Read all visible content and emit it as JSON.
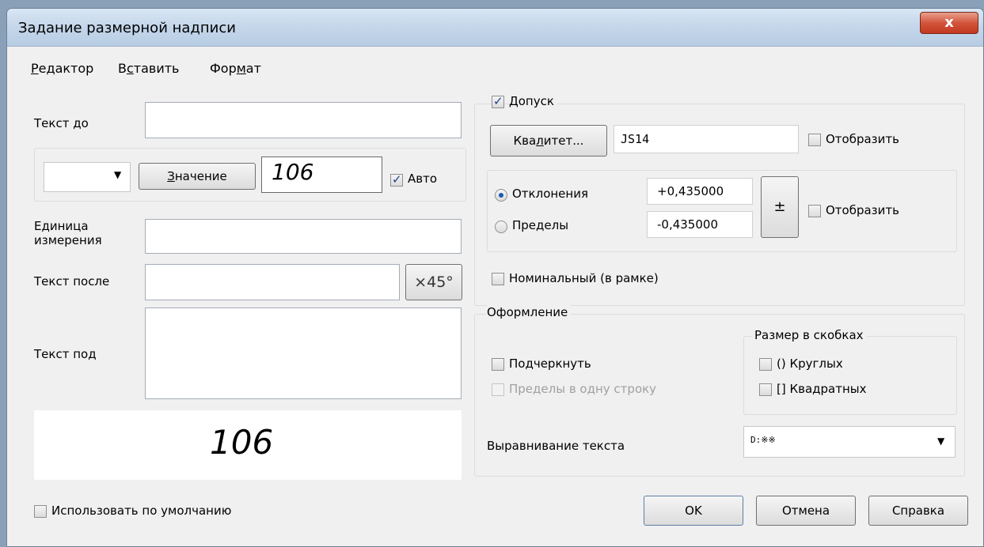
{
  "window": {
    "title": "Задание размерной надписи",
    "close_glyph": "x"
  },
  "menu": [
    {
      "pre": "",
      "acc": "Р",
      "post": "едактор"
    },
    {
      "pre": "В",
      "acc": "с",
      "post": "тавить"
    },
    {
      "pre": "Фор",
      "acc": "м",
      "post": "ат"
    }
  ],
  "left": {
    "text_before_label": "Текст до",
    "text_before_value": "",
    "prefix_select_value": "",
    "value_button": {
      "acc": "З",
      "post": "начение"
    },
    "value": "106",
    "auto_label": "Авто",
    "unit_label_line1": "Единица",
    "unit_label_line2": "измерения",
    "unit_value": "",
    "text_after_label": "Текст после",
    "text_after_value": "",
    "x45_button": "×45°",
    "text_under_label": "Текст под",
    "text_under_value": "",
    "preview_value": "106",
    "use_default_label": "Использовать по умолчанию"
  },
  "tolerance": {
    "enabled_label": "Допуск",
    "qualitet_button": {
      "pre": "Ква",
      "acc": "л",
      "post": "итет..."
    },
    "qualitet_value": "JS14",
    "show_label": "Отобразить",
    "deviations_label": "Отклонения",
    "limits_label": "Пределы",
    "upper_value": "+0,435000",
    "lower_value": "-0,435000",
    "plusminus_button": "±",
    "show2_label": "Отобразить",
    "nominal_label": "Номинальный (в рамке)"
  },
  "format": {
    "group_label": "Оформление",
    "brackets_group_label": "Размер в скобках",
    "underline_label": "Подчеркнуть",
    "limits_one_line_label": "Пределы в одну строку",
    "round_label": "() Круглых",
    "square_label": "[] Квадратных",
    "align_label": "Выравнивание текста",
    "align_value": "D:※※"
  },
  "buttons": {
    "ok": "OK",
    "cancel": "Отмена",
    "help": "Справка"
  }
}
